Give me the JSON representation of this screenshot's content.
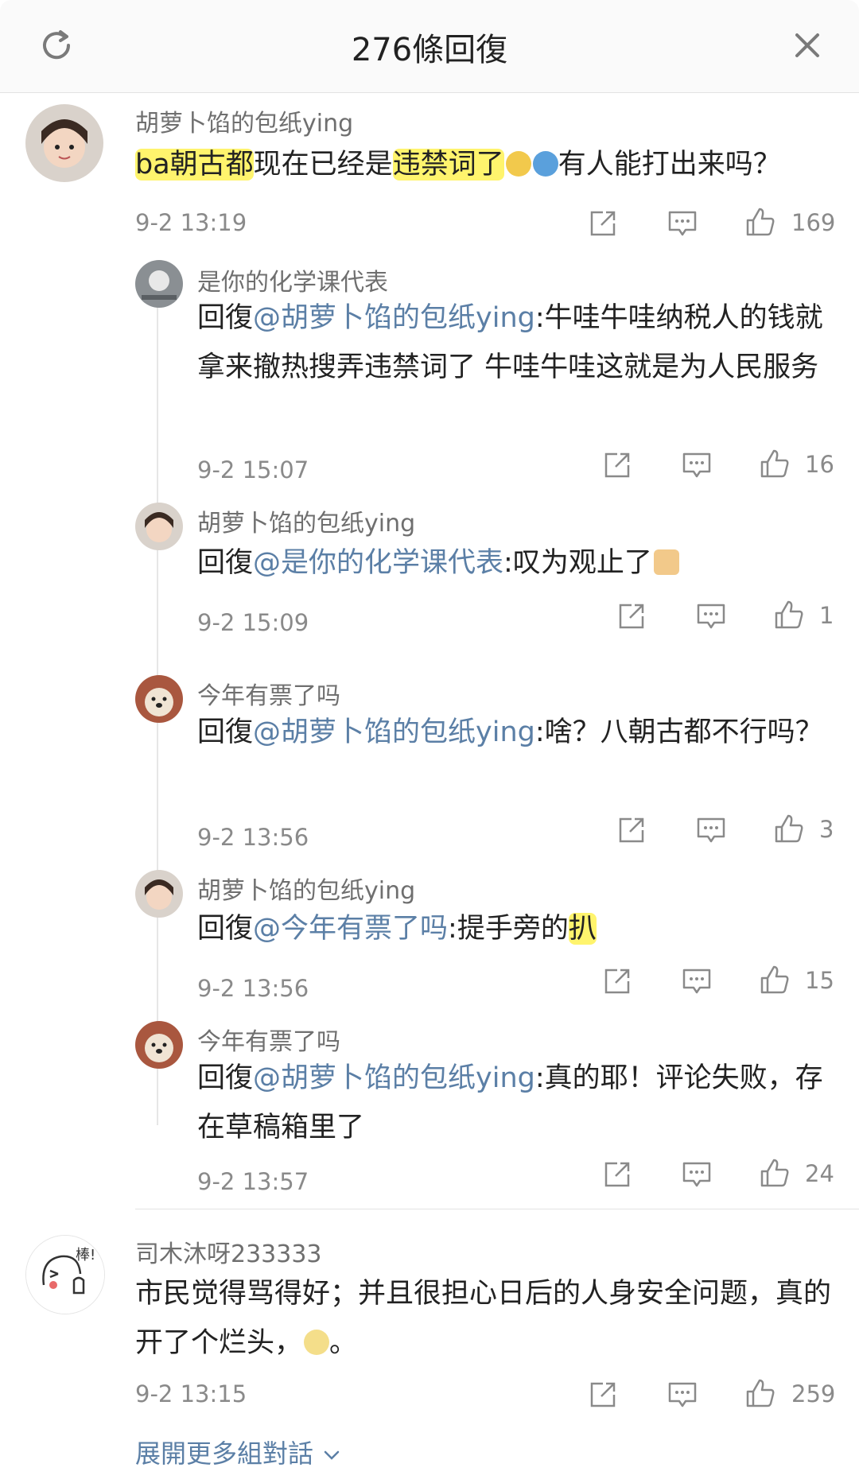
{
  "header": {
    "title": "276條回復",
    "refresh_icon": "refresh-icon",
    "close_icon": "close-icon"
  },
  "colors": {
    "mention": "#5b7fa6",
    "highlight": "#fff03c",
    "meta": "#8a8a8a"
  },
  "main_comment": {
    "author": "胡萝卜馅的包纸ying",
    "text_part1": "ba朝古都",
    "text_part2": "现在已经是",
    "text_part3": "违禁词了",
    "text_part4": "有人能打出来吗？",
    "time": "9-2 13:19",
    "likes": "169"
  },
  "replies": [
    {
      "author": "是你的化学课代表",
      "prefix": "回復",
      "mention": "@胡萝卜馅的包纸ying",
      "text": ":牛哇牛哇纳税人的钱就拿来撤热搜弄违禁词了 牛哇牛哇这就是为人民服务",
      "time": "9-2 15:07",
      "likes": "16"
    },
    {
      "author": "胡萝卜馅的包纸ying",
      "prefix": "回復",
      "mention": "@是你的化学课代表",
      "text": ":叹为观止了",
      "time": "9-2 15:09",
      "likes": "1"
    },
    {
      "author": "今年有票了吗",
      "prefix": "回復",
      "mention": "@胡萝卜馅的包纸ying",
      "text": ":啥？八朝古都不行吗？",
      "time": "9-2 13:56",
      "likes": "3"
    },
    {
      "author": "胡萝卜馅的包纸ying",
      "prefix": "回復",
      "mention": "@今年有票了吗",
      "text": ":提手旁的",
      "text_highlight": "扒",
      "time": "9-2 13:56",
      "likes": "15"
    },
    {
      "author": "今年有票了吗",
      "prefix": "回復",
      "mention": "@胡萝卜馅的包纸ying",
      "text": ":真的耶！评论失败，存在草稿箱里了",
      "time": "9-2 13:57",
      "likes": "24"
    }
  ],
  "second_comment": {
    "author": "司木沐呀233333",
    "avatar_text": "棒!",
    "text": "市民觉得骂得好；并且很担心日后的人身安全问题，真的开了个烂头，",
    "text_end": "。",
    "time": "9-2 13:15",
    "likes": "259"
  },
  "expand_link": "展開更多組對話"
}
